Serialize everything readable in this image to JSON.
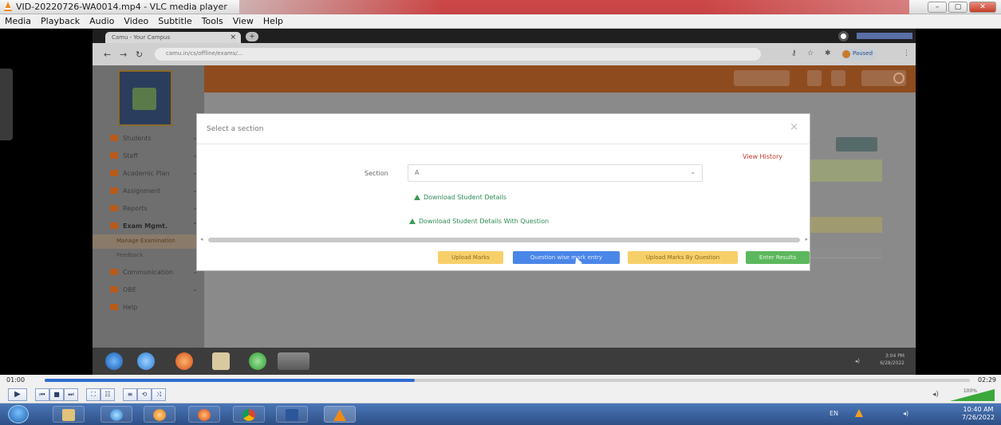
{
  "window": {
    "title": "VID-20220726-WA0014.mp4 - VLC media player"
  },
  "menubar": [
    "Media",
    "Playback",
    "Audio",
    "Video",
    "Subtitle",
    "Tools",
    "View",
    "Help"
  ],
  "browser": {
    "tab_title": "Camu - Your Campus",
    "url": "camu.in/cs/offline/exams/...",
    "paused_label": "Paused"
  },
  "web": {
    "college_name": "",
    "sidebar": [
      {
        "label": "Students",
        "has_chevron": true
      },
      {
        "label": "Staff",
        "has_chevron": true
      },
      {
        "label": "Academic Plan",
        "has_chevron": true
      },
      {
        "label": "Assignment",
        "has_chevron": true
      },
      {
        "label": "Reports",
        "has_chevron": true
      },
      {
        "label": "Exam Mgmt.",
        "has_chevron": true,
        "active": true
      }
    ],
    "sub_items": [
      "Manage Examination",
      "Feedback"
    ],
    "sidebar_after": [
      {
        "label": "Communication",
        "has_chevron": true
      },
      {
        "label": "OBE",
        "has_chevron": true
      },
      {
        "label": "Help",
        "has_chevron": false
      }
    ]
  },
  "modal": {
    "title": "Select a section",
    "close": "×",
    "view_history": "View History",
    "section_label": "Section",
    "section_value": "A",
    "download_details": "Download Student Details",
    "download_details_question": "Download Student Details With Question",
    "buttons": {
      "upload_marks": "Upload Marks",
      "question_wise": "Question wise mark entry",
      "upload_marks_question": "Upload Marks By Question",
      "enter_results": "Enter Results"
    }
  },
  "inner_taskbar": {
    "time": "3:04 PM",
    "date": "6/28/2022"
  },
  "player": {
    "elapsed": "01:00",
    "total": "02:29",
    "progress": 0.4,
    "volume_pct": "100%"
  },
  "taskbar": {
    "lang": "EN",
    "time": "10:40 AM",
    "date": "7/26/2022"
  },
  "colors": {
    "accent_orange": "#8e4c1e",
    "link_green": "#2e8b57",
    "primary_blue": "#4a86e8",
    "warning_yellow": "#f7cf6a",
    "success_green": "#5cb85c"
  }
}
